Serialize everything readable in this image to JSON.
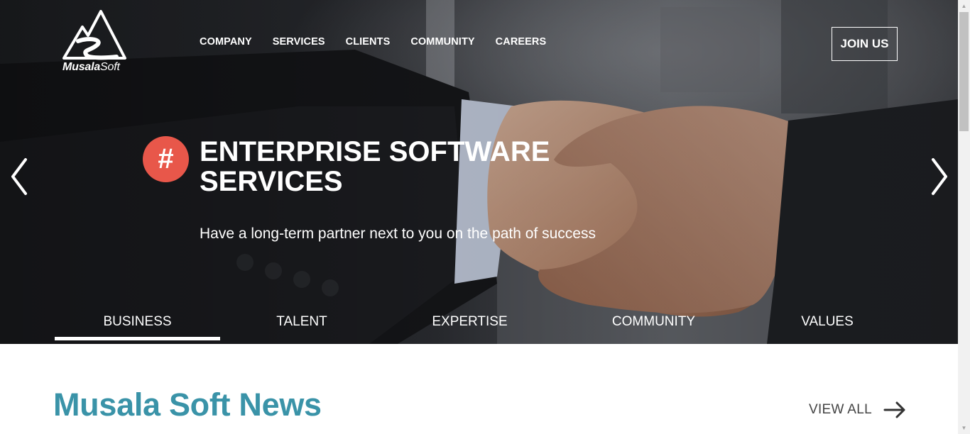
{
  "brand": {
    "logo_bold": "Musala",
    "logo_light": "Soft"
  },
  "nav": {
    "items": [
      {
        "label": "COMPANY"
      },
      {
        "label": "SERVICES"
      },
      {
        "label": "CLIENTS"
      },
      {
        "label": "COMMUNITY"
      },
      {
        "label": "CAREERS"
      }
    ],
    "join_label": "JOIN US"
  },
  "hero": {
    "badge": "#",
    "title": "ENTERPRISE SOFTWARE SERVICES",
    "subtitle": "Have a long-term partner next to you on the path of success",
    "prev_icon": "chevron-left-icon",
    "next_icon": "chevron-right-icon"
  },
  "tabs": [
    {
      "label": "BUSINESS",
      "active": true
    },
    {
      "label": "TALENT",
      "active": false
    },
    {
      "label": "EXPERTISE",
      "active": false
    },
    {
      "label": "COMMUNITY",
      "active": false
    },
    {
      "label": "VALUES",
      "active": false
    }
  ],
  "news": {
    "title": "Musala Soft News",
    "view_all": "VIEW ALL",
    "view_all_icon": "arrow-right-icon"
  },
  "colors": {
    "accent_badge": "#e8574a",
    "news_title": "#3a93a8",
    "hero_text": "#ffffff"
  }
}
